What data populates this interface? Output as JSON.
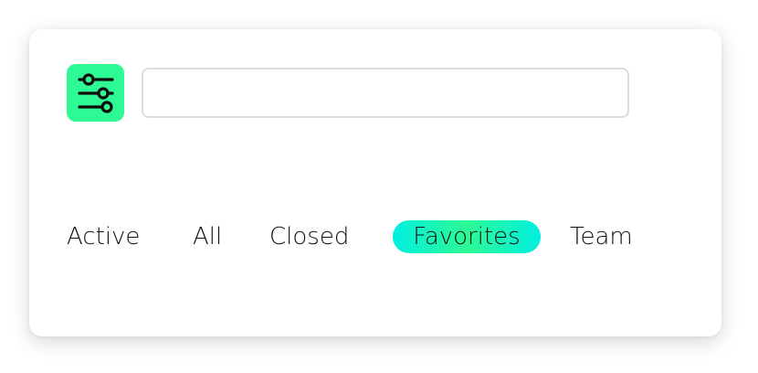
{
  "filter_button": {
    "icon": "sliders-icon",
    "color": "#2dfa95"
  },
  "search": {
    "value": "",
    "placeholder": ""
  },
  "tabs": [
    {
      "label": "Active",
      "selected": false
    },
    {
      "label": "All",
      "selected": false
    },
    {
      "label": "Closed",
      "selected": false
    },
    {
      "label": "Favorites",
      "selected": true
    },
    {
      "label": "Team",
      "selected": false
    }
  ],
  "colors": {
    "accent_green": "#2dfa95",
    "accent_cyan": "#00efe0",
    "text": "#111111",
    "input_border": "#dcdcdc"
  }
}
